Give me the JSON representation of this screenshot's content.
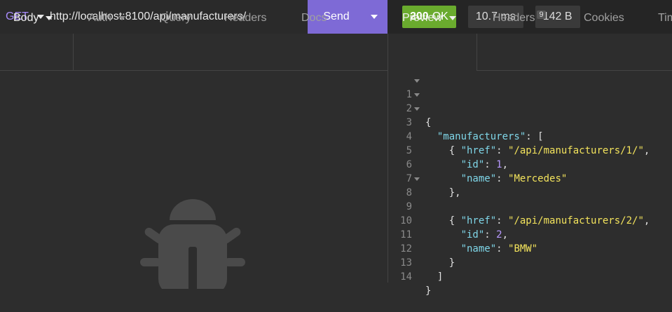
{
  "request": {
    "method": "GET",
    "url": "http://localhost:8100/api/manufacturers/",
    "send_label": "Send"
  },
  "response": {
    "status_code": "200",
    "status_text": "OK",
    "time": "10.7 ms",
    "size": "142 B"
  },
  "left_tabs": [
    {
      "label": "Body"
    },
    {
      "label": "Auth"
    },
    {
      "label": "Query"
    },
    {
      "label": "Headers"
    },
    {
      "label": "Docs"
    }
  ],
  "right_tabs": [
    {
      "label": "Preview"
    },
    {
      "label": "Headers",
      "badge": "9"
    },
    {
      "label": "Cookies"
    },
    {
      "label": "Tim"
    }
  ],
  "code_lines": [
    {
      "n": "1",
      "fold": true
    },
    {
      "n": "2",
      "fold": true
    },
    {
      "n": "3",
      "fold": true
    },
    {
      "n": "4",
      "fold": false
    },
    {
      "n": "5",
      "fold": false
    },
    {
      "n": "6",
      "fold": false
    },
    {
      "n": "7",
      "fold": false
    },
    {
      "n": "8",
      "fold": true
    },
    {
      "n": "9",
      "fold": false
    },
    {
      "n": "10",
      "fold": false
    },
    {
      "n": "11",
      "fold": false
    },
    {
      "n": "12",
      "fold": false
    },
    {
      "n": "13",
      "fold": false
    },
    {
      "n": "14",
      "fold": false
    }
  ],
  "json_tokens": {
    "open_brace": "{",
    "close_brace": "}",
    "manufacturers_key": "\"manufacturers\"",
    "colon_bracket": ": [",
    "close_bracket": "]",
    "obj_open": "{",
    "obj_close": "},",
    "obj_close_last": "}",
    "href_key": "\"href\"",
    "id_key": "\"id\"",
    "name_key": "\"name\"",
    "href1": "\"/api/manufacturers/1/\"",
    "id1": "1",
    "name1": "\"Mercedes\"",
    "href2": "\"/api/manufacturers/2/\"",
    "id2": "2",
    "name2": "\"BMW\""
  },
  "icons": {
    "method_dropdown": "caret-down-icon",
    "send_dropdown": "caret-down-icon",
    "empty_body": "bug-icon"
  },
  "colors": {
    "send_button": "#7e6ad6",
    "status_ok": "#6aab2e",
    "method": "#a78bfa",
    "json_key": "#7fd6e8",
    "json_string": "#f3e35c",
    "json_number": "#b899ff"
  }
}
